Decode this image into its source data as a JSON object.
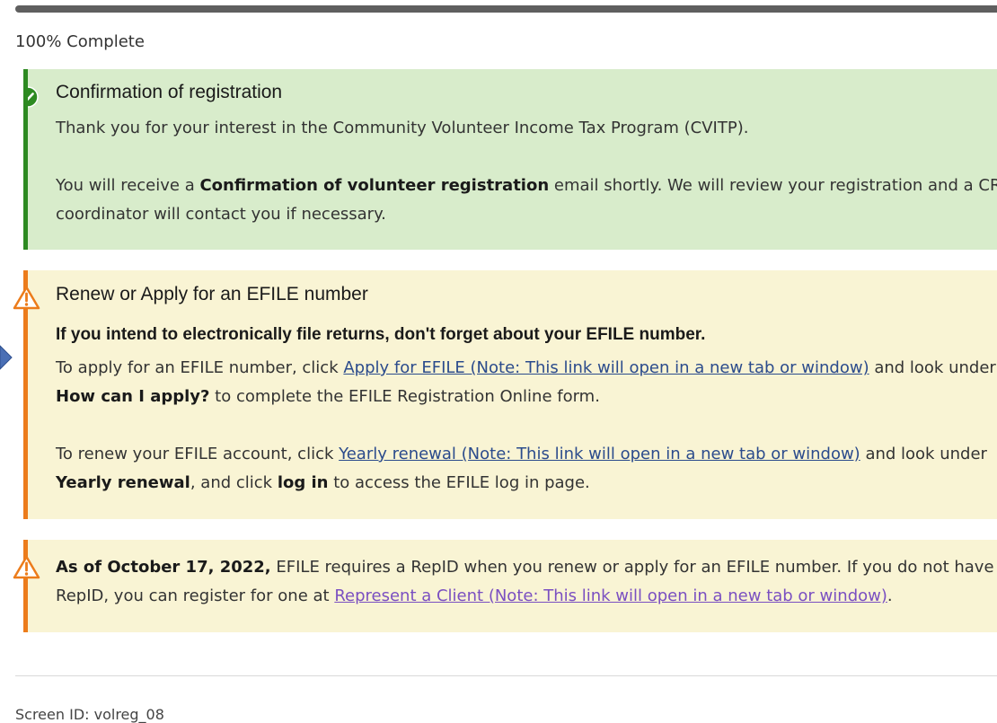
{
  "progress": {
    "percent": 100,
    "label": "100% Complete"
  },
  "confirmation": {
    "heading": "Confirmation of registration",
    "para1": "Thank you for your interest in the Community Volunteer Income Tax Program (CVITP).",
    "para2_pre": "You will receive a ",
    "para2_bold": "Confirmation of volunteer registration",
    "para2_post": " email shortly. We will review your registration and a CRA",
    "para2_line2": "coordinator will contact you if necessary."
  },
  "efile": {
    "heading": "Renew or Apply for an EFILE number",
    "subheading": "If you intend to electronically file returns, don't forget about your EFILE number.",
    "apply_pre": "To apply for an EFILE number, click ",
    "apply_link": "Apply for EFILE (Note: This link will open in a new tab or window)",
    "apply_post": " and look under",
    "apply_bold": "How can I apply?",
    "apply_post2": " to complete the EFILE Registration Online form.",
    "renew_pre": "To renew your EFILE account, click ",
    "renew_link": "Yearly renewal (Note: This link will open in a new tab or window)",
    "renew_post": " and look under",
    "renew_bold1": "Yearly renewal",
    "renew_mid": ", and click ",
    "renew_bold2": "log in",
    "renew_post2": " to access the EFILE log in page."
  },
  "repid": {
    "bold": "As of October 17, 2022,",
    "text1": " EFILE requires a RepID when you renew or apply for an EFILE number. If you do not have a",
    "text2_pre": "RepID, you can register for one at ",
    "link": "Represent a Client (Note: This link will open in a new tab or window)",
    "text2_post": "."
  },
  "footer": {
    "screen_id": "Screen ID: volreg_08"
  },
  "colors": {
    "success_bg": "#d8eccb",
    "success_border": "#2d8a21",
    "warning_bg": "#f9f4d4",
    "warning_border": "#ec7c1b",
    "link": "#2b4b8c",
    "visited_link": "#7a4fc1"
  },
  "icons": {
    "success": "check-circle-icon",
    "warning": "warning-triangle-icon",
    "side": "chevron-right-icon"
  }
}
